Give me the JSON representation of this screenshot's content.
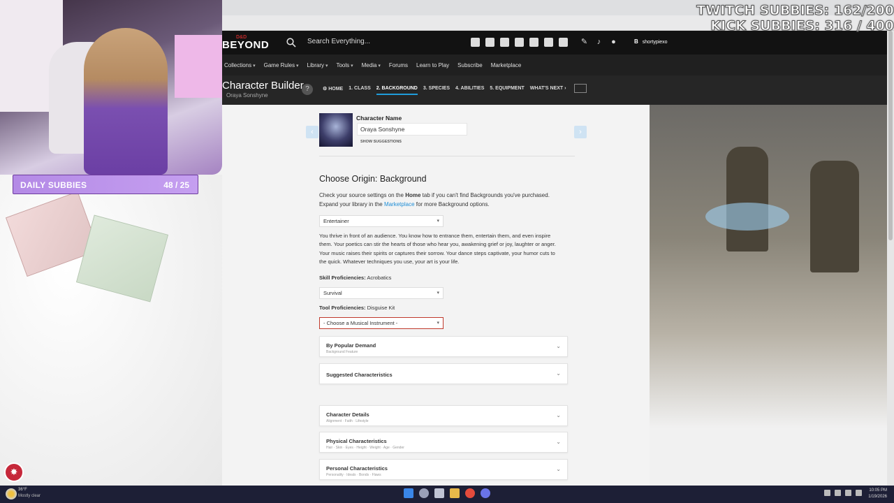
{
  "site": {
    "logo_small": "D&D",
    "logo_main": "BEYOND",
    "search_placeholder": "Search Everything...",
    "username_initial": "B",
    "username": "shortypiexo"
  },
  "mainnav": [
    {
      "label": "Collections",
      "dropdown": true
    },
    {
      "label": "Game Rules",
      "dropdown": true
    },
    {
      "label": "Library",
      "dropdown": true
    },
    {
      "label": "Tools",
      "dropdown": true
    },
    {
      "label": "Media",
      "dropdown": true
    },
    {
      "label": "Forums",
      "dropdown": false
    },
    {
      "label": "Learn to Play",
      "dropdown": false
    },
    {
      "label": "Subscribe",
      "dropdown": false
    },
    {
      "label": "Marketplace",
      "dropdown": false
    }
  ],
  "builder": {
    "title": "Character Builder",
    "character_subtitle": "Oraya Sonshyne",
    "help": "?",
    "steps": [
      "⚙ HOME",
      "1. CLASS",
      "2. BACKGROUND",
      "3. SPECIES",
      "4. ABILITIES",
      "5. EQUIPMENT",
      "WHAT'S NEXT ›"
    ],
    "active_step": "2. BACKGROUND"
  },
  "character": {
    "name_label": "Character Name",
    "name_value": "Oraya Sonshyne",
    "suggestions_link": "SHOW SUGGESTIONS"
  },
  "background": {
    "heading": "Choose Origin: Background",
    "intro_1a": "Check your source settings on the ",
    "intro_1b": "Home",
    "intro_1c": " tab if you can't find Backgrounds you've purchased.",
    "intro_2a": "Expand your library in the ",
    "intro_2b": "Marketplace",
    "intro_2c": " for more Background options.",
    "selected": "Entertainer",
    "description": "You thrive in front of an audience. You know how to entrance them, entertain them, and even inspire them. Your poetics can stir the hearts of those who hear you, awakening grief or joy, laughter or anger. Your music raises their spirits or captures their sorrow. Your dance steps captivate, your humor cuts to the quick. Whatever techniques you use, your art is your life.",
    "skill_label": "Skill Proficiencies:",
    "skill_value": "Acrobatics",
    "skill_select": "Survival",
    "tool_label": "Tool Proficiencies:",
    "tool_value": "Disguise Kit",
    "tool_select": "- Choose a Musical Instrument -"
  },
  "accordions": [
    {
      "title": "By Popular Demand",
      "sub": "Background Feature"
    },
    {
      "title": "Suggested Characteristics",
      "sub": ""
    },
    {
      "title": "Character Details",
      "sub": "Alignment  ·  Faith  ·  Lifestyle"
    },
    {
      "title": "Physical Characteristics",
      "sub": "Hair  ·  Skin  ·  Eyes  ·  Height  ·  Weight  ·  Age  ·  Gender"
    },
    {
      "title": "Personal Characteristics",
      "sub": "Personality  ·  Ideals  ·  Bonds  ·  Flaws"
    }
  ],
  "overlay": {
    "daily_label": "DAILY SUBBIES",
    "daily_value": "48 / 25",
    "twitch_goal": "TWITCH SUBBIES: 162/200",
    "kick_goal": "KICK SUBBIES: 316 / 400"
  },
  "taskbar": {
    "temp": "36°F",
    "weather": "Mostly clear",
    "time": "10:05 PM",
    "date": "1/19/2026"
  }
}
